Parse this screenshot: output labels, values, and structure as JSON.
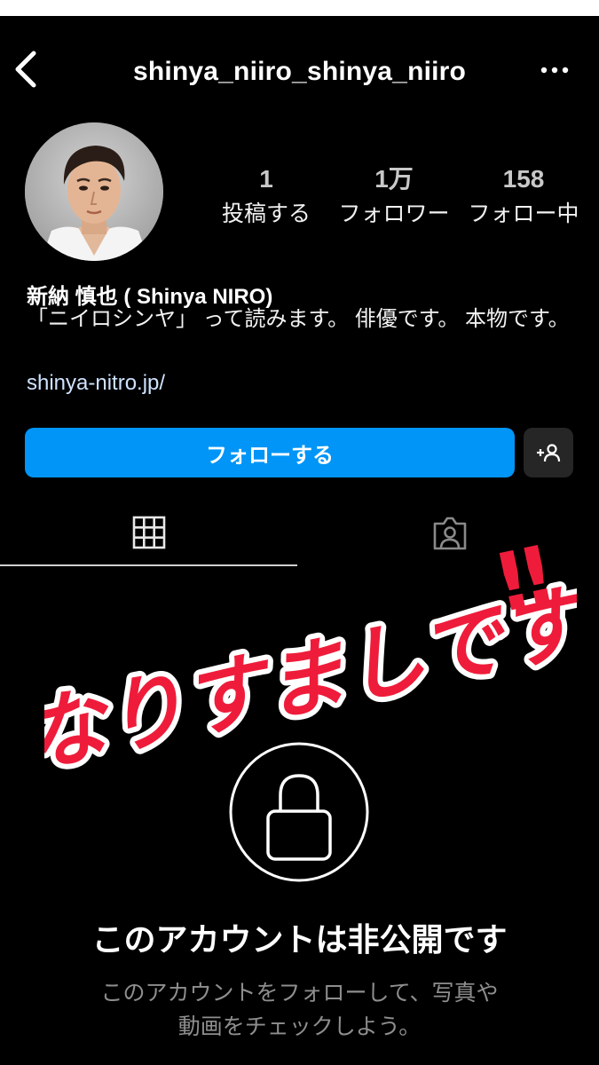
{
  "header": {
    "username": "shinya_niiro_shinya_niiro",
    "back_icon": "chevron-left-icon",
    "more_icon": "more-dots-icon"
  },
  "profile": {
    "stats": [
      {
        "value": "1",
        "label": "投稿する"
      },
      {
        "value": "1万",
        "label": "フォロワー"
      },
      {
        "value": "158",
        "label": "フォロー中"
      }
    ],
    "name": "新納 慎也 ( Shinya NIRO)",
    "bio": "「ニイロシンヤ」 って読みます。 俳優です。 本物です。",
    "link": "shinya-nitro.jp/"
  },
  "actions": {
    "follow_label": "フォローする",
    "suggest_icon": "add-person-icon"
  },
  "tabs": {
    "grid_icon": "grid-icon",
    "tagged_icon": "tagged-person-icon"
  },
  "overlay": {
    "text": "なりすましです",
    "mark": "‼"
  },
  "private": {
    "title": "このアカウントは非公開です",
    "desc_line1": "このアカウントをフォローして、写真や",
    "desc_line2": "動画をチェックしよう。"
  },
  "colors": {
    "background": "#000000",
    "accent": "#0095f6",
    "overlay_text": "#ee1c3a"
  }
}
